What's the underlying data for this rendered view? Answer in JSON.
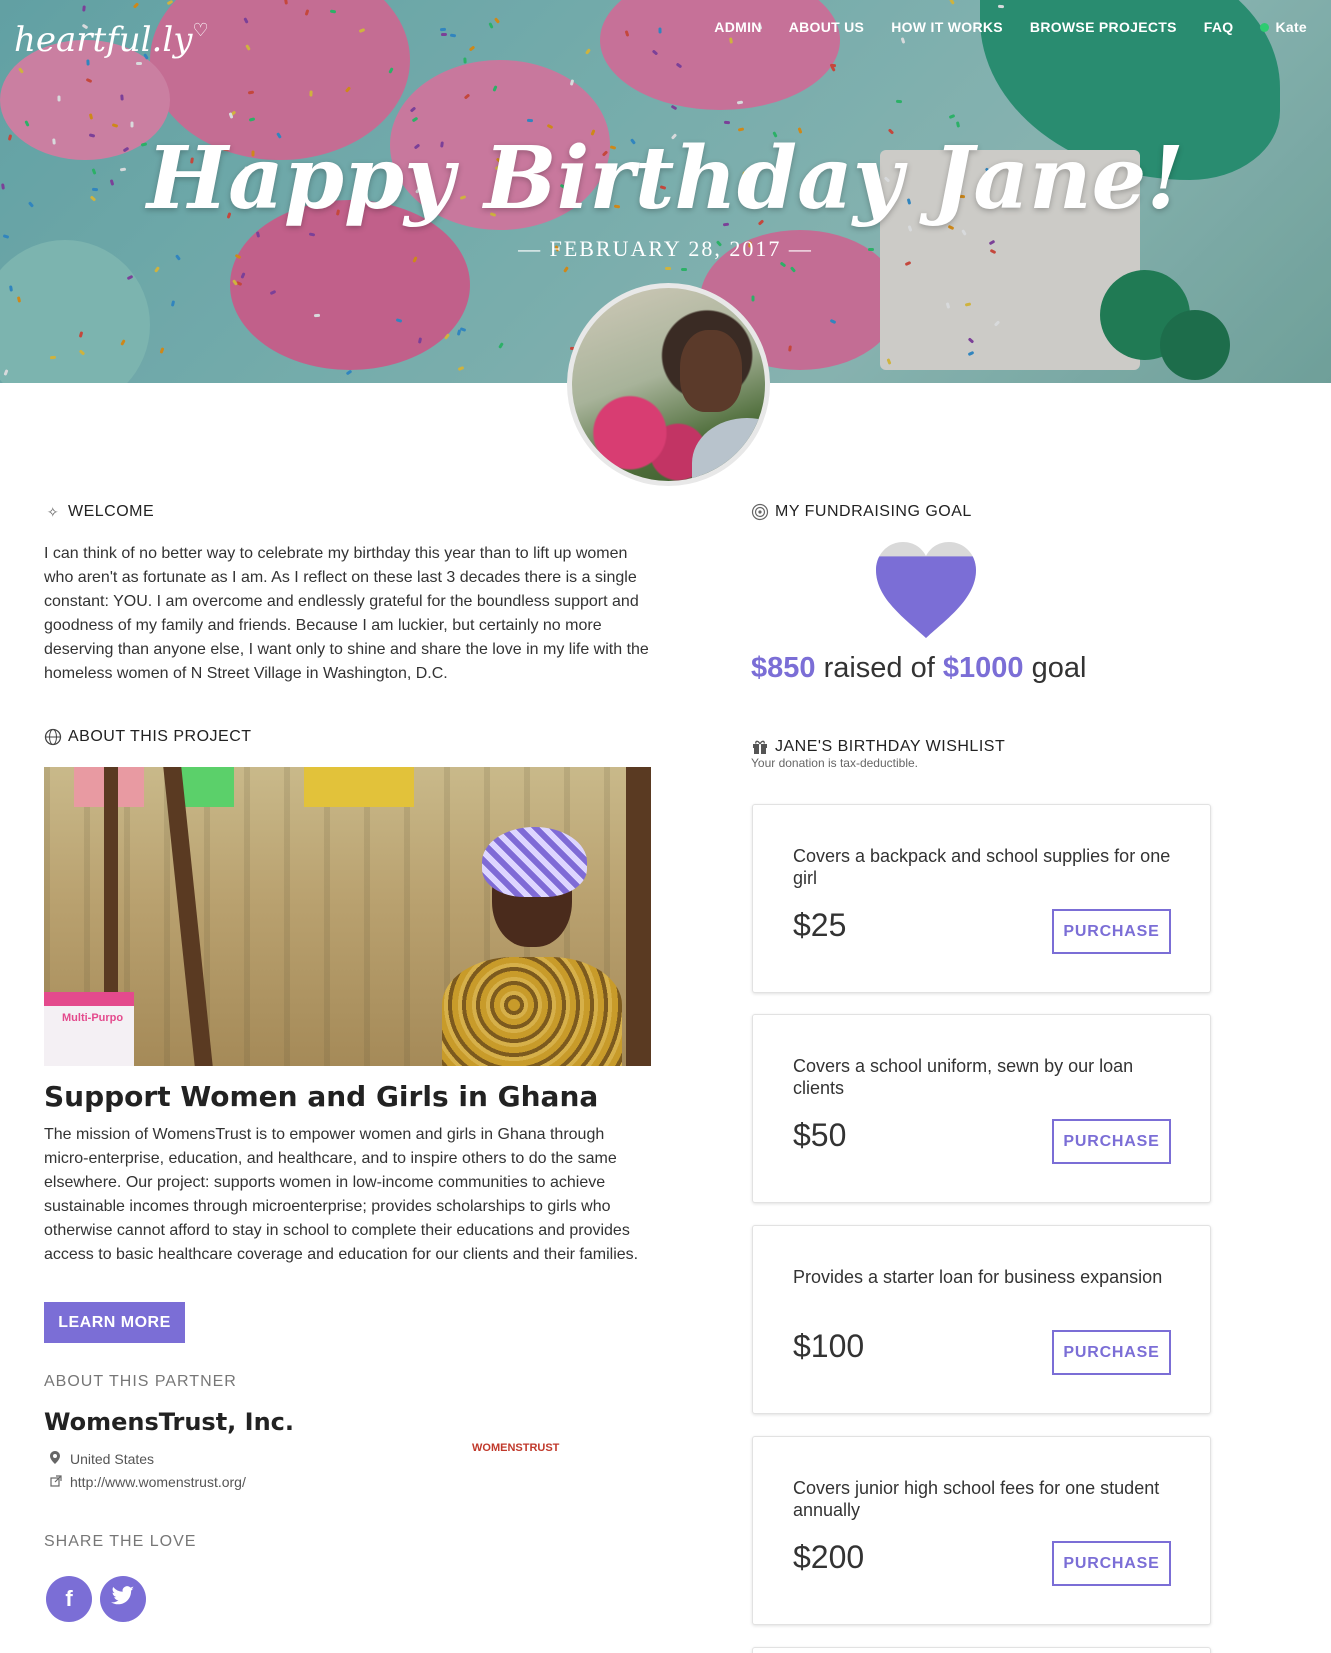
{
  "header": {
    "logo": "heartful.ly",
    "nav": [
      "ADMIN",
      "ABOUT US",
      "HOW IT WORKS",
      "BROWSE PROJECTS",
      "FAQ"
    ],
    "user": "Kate"
  },
  "hero": {
    "title": "Happy Birthday Jane!",
    "date": "— FEBRUARY 28, 2017 —"
  },
  "welcome": {
    "heading": "WELCOME",
    "text": "I can think of no better way to celebrate my birthday this year than to lift up women who aren't as fortunate as I am. As I reflect on these last 3 decades there is a single constant: YOU. I am overcome and endlessly grateful for the boundless support and goodness of my family and friends. Because I am luckier, but certainly no more deserving than anyone else, I want only to shine and share the love in my life with the homeless women of N Street Village in Washington, D.C."
  },
  "project": {
    "heading": "ABOUT THIS PROJECT",
    "image_text": "Multi-Purpo",
    "title": "Support Women and Girls in Ghana",
    "text": "The mission of WomensTrust is to empower women and girls in Ghana through micro-enterprise, education, and healthcare, and to inspire others to do the same elsewhere. Our project: supports women in low-income communities to achieve sustainable incomes through microenterprise; provides scholarships to girls who otherwise cannot afford to stay in school to complete their educations and provides access to basic healthcare coverage and education for our clients and their families.",
    "learn_more": "LEARN MORE"
  },
  "partner": {
    "heading": "ABOUT THIS PARTNER",
    "name": "WomensTrust, Inc.",
    "location": "United States",
    "url": "http://www.womenstrust.org/",
    "logo_text": "WOMENSTRUST"
  },
  "share": {
    "heading": "SHARE THE LOVE",
    "facebook": "f",
    "twitter": "t"
  },
  "goal": {
    "heading": "MY FUNDRAISING GOAL",
    "raised": "$850",
    "raised_mid": " raised of ",
    "target": "$1000",
    "suffix": " goal",
    "progress_fraction": 0.85
  },
  "wishlist": {
    "heading": "JANE'S BIRTHDAY WISHLIST",
    "note": "Your donation is tax-deductible.",
    "items": [
      {
        "desc": "Covers a backpack and school supplies for one girl",
        "price": "$25",
        "button": "PURCHASE"
      },
      {
        "desc": "Covers a school uniform, sewn by our loan clients",
        "price": "$50",
        "button": "PURCHASE"
      },
      {
        "desc": "Provides a starter loan for business expansion",
        "price": "$100",
        "button": "PURCHASE"
      },
      {
        "desc": "Covers junior high school fees for one student annually",
        "price": "$200",
        "button": "PURCHASE"
      }
    ]
  },
  "colors": {
    "accent": "#7b6ed6",
    "online": "#2ecc71"
  }
}
